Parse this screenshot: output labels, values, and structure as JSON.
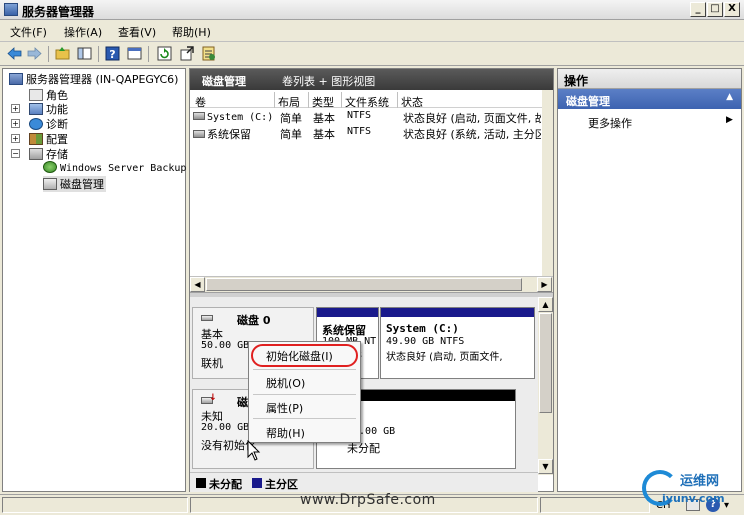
{
  "window": {
    "title": "服务器管理器",
    "controls": {
      "minimize": "_",
      "maximize": "□",
      "close": "X"
    }
  },
  "menu": [
    "文件(F)",
    "操作(A)",
    "查看(V)",
    "帮助(H)"
  ],
  "toolbar": {
    "icons": [
      "back-arrow-icon",
      "forward-arrow-icon",
      "up-folder-icon",
      "show-hide-tree-icon",
      "help-icon",
      "console-icon",
      "refresh-icon",
      "export-icon",
      "properties-icon"
    ]
  },
  "tree": {
    "root": "服务器管理器 (IN-QAPEGYC6)",
    "roles": "角色",
    "features": "功能",
    "diagnostics": "诊断",
    "configuration": "配置",
    "storage": "存储",
    "backup": "Windows Server Backup",
    "disk_management": "磁盘管理"
  },
  "center": {
    "title": "磁盘管理",
    "view": "卷列表 + 图形视图",
    "columns": [
      "卷",
      "布局",
      "类型",
      "文件系统",
      "状态"
    ],
    "rows": [
      {
        "volume": "System (C:)",
        "layout": "简单",
        "type": "基本",
        "fs": "NTFS",
        "status": "状态良好 (启动, 页面文件, 故"
      },
      {
        "volume": "系统保留",
        "layout": "简单",
        "type": "基本",
        "fs": "NTFS",
        "status": "状态良好 (系统, 活动, 主分区"
      }
    ],
    "disks": [
      {
        "name": "磁盘 0",
        "kind": "基本",
        "size": "50.00 GB",
        "state": "联机",
        "partitions": [
          {
            "name": "系统保留",
            "size": "100 MB NT",
            "status": "状态良好"
          },
          {
            "name": "System  (C:)",
            "size": "49.90 GB NTFS",
            "status": "状态良好 (启动, 页面文件,"
          }
        ]
      },
      {
        "name": "磁盘 1",
        "kind": "未知",
        "size": "20.00 GB",
        "state": "没有初始化",
        "partitions": [
          {
            "name": "",
            "size": "20.00 GB",
            "status": "未分配"
          }
        ]
      }
    ],
    "legend": [
      {
        "label": "未分配",
        "color": "#000000"
      },
      {
        "label": "主分区",
        "color": "#1a1a8c"
      }
    ]
  },
  "context_menu": [
    "初始化磁盘(I)",
    "脱机(O)",
    "属性(P)",
    "帮助(H)"
  ],
  "actions": {
    "header": "操作",
    "section": "磁盘管理",
    "more": "更多操作"
  },
  "statusbar": {
    "lang": "CH"
  },
  "watermark": {
    "url": "www.DrpSafe.com",
    "logo_cn": "运维网",
    "logo_en": "iyunv.com"
  },
  "colors": {
    "primary_partition": "#1a1a8c",
    "unallocated": "#000000",
    "action_section": "#4a6fbf",
    "highlight_ring": "#e02020"
  }
}
